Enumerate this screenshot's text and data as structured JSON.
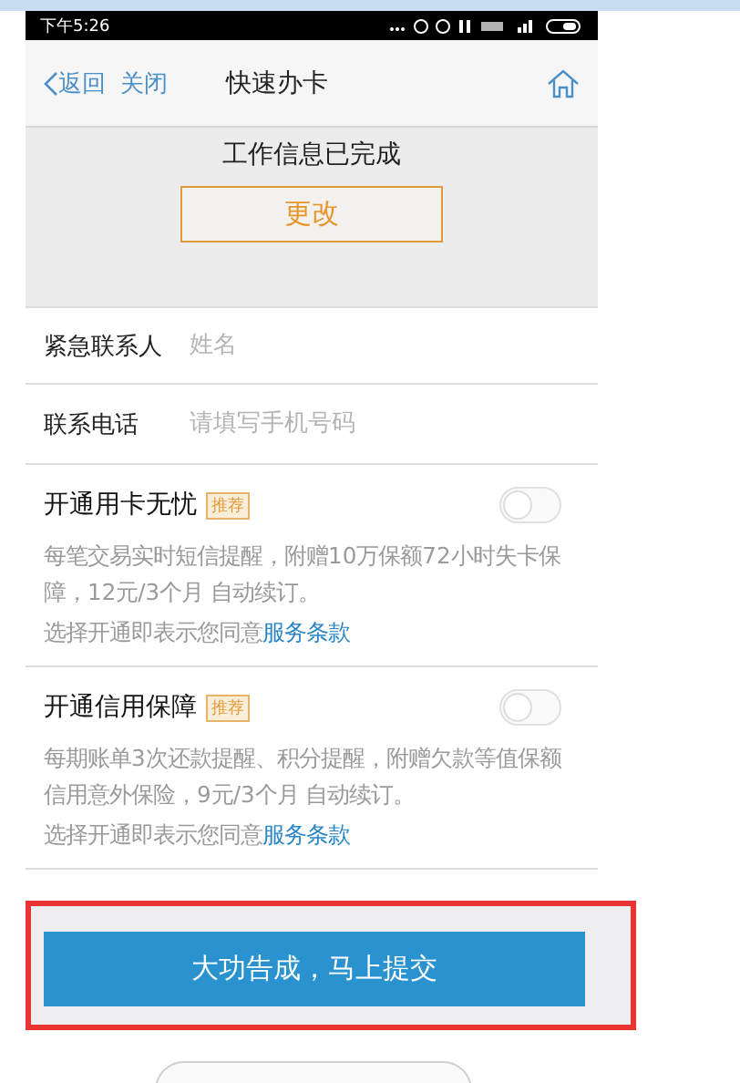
{
  "status_bar": {
    "time": "下午5:26"
  },
  "nav": {
    "back": "返回",
    "close": "关闭",
    "title": "快速办卡"
  },
  "summary": {
    "message": "工作信息已完成",
    "edit_button": "更改"
  },
  "fields": [
    {
      "label": "紧急联系人",
      "placeholder": "姓名"
    },
    {
      "label": "联系电话",
      "placeholder": "请填写手机号码"
    }
  ],
  "services": [
    {
      "title": "开通用卡无忧",
      "badge": "推荐",
      "on": false,
      "description": "每笔交易实时短信提醒，附赠10万保额72小时失卡保障，12元/3个月 自动续订。",
      "agreement": "选择开通即表示您同意",
      "link": "服务条款"
    },
    {
      "title": "开通信用保障",
      "badge": "推荐",
      "on": false,
      "description": "每期账单3次还款提醒、积分提醒，附赠欠款等值保额信用意外保险，9元/3个月 自动续订。",
      "agreement": "选择开通即表示您同意",
      "link": "服务条款"
    }
  ],
  "submit_button": "大功告成，马上提交"
}
